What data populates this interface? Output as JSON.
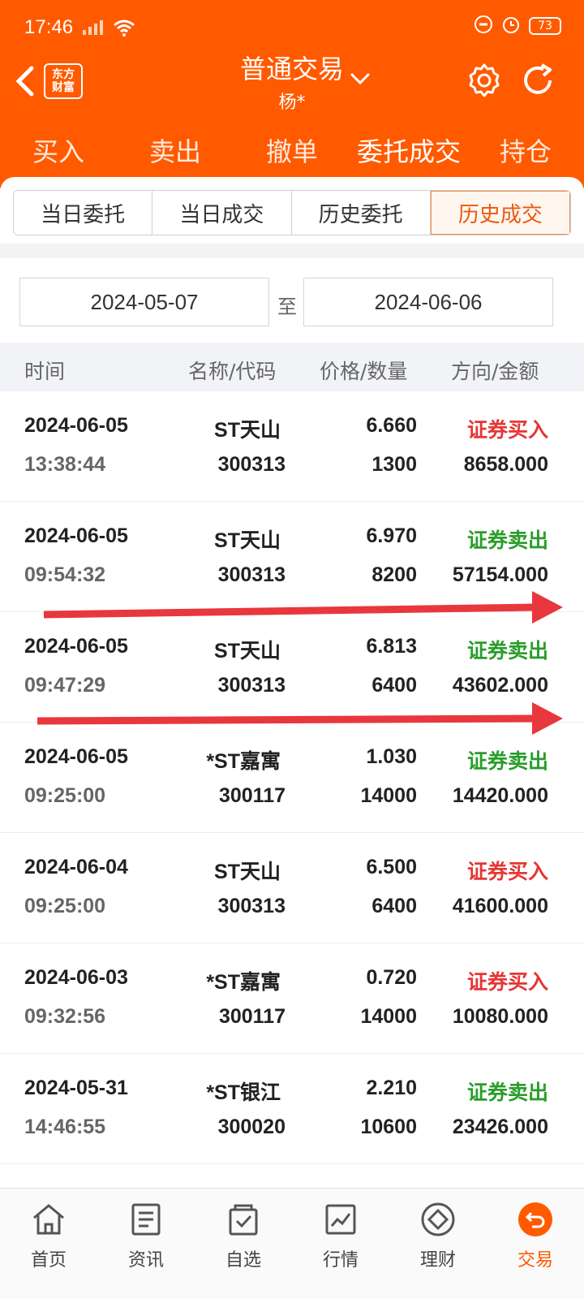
{
  "status_bar": {
    "time": "17:46",
    "battery": "73"
  },
  "header": {
    "logo_line1": "东方",
    "logo_line2": "财富",
    "title": "普通交易",
    "subtitle": "杨*"
  },
  "main_tabs": [
    {
      "label": "买入"
    },
    {
      "label": "卖出"
    },
    {
      "label": "撤单"
    },
    {
      "label": "委托成交",
      "active": true
    },
    {
      "label": "持仓"
    }
  ],
  "sub_tabs": [
    {
      "label": "当日委托"
    },
    {
      "label": "当日成交"
    },
    {
      "label": "历史委托"
    },
    {
      "label": "历史成交",
      "active": true
    }
  ],
  "date_range": {
    "start": "2024-05-07",
    "separator": "至",
    "end": "2024-06-06"
  },
  "table": {
    "headers": [
      "时间",
      "名称/代码",
      "价格/数量",
      "方向/金额"
    ],
    "rows": [
      {
        "date": "2024-06-05",
        "time": "13:38:44",
        "name": "ST天山",
        "code": "300313",
        "price": "6.660",
        "qty": "1300",
        "direction": "证券买入",
        "amount": "8658.000",
        "side": "buy"
      },
      {
        "date": "2024-06-05",
        "time": "09:54:32",
        "name": "ST天山",
        "code": "300313",
        "price": "6.970",
        "qty": "8200",
        "direction": "证券卖出",
        "amount": "57154.000",
        "side": "sell"
      },
      {
        "date": "2024-06-05",
        "time": "09:47:29",
        "name": "ST天山",
        "code": "300313",
        "price": "6.813",
        "qty": "6400",
        "direction": "证券卖出",
        "amount": "43602.000",
        "side": "sell"
      },
      {
        "date": "2024-06-05",
        "time": "09:25:00",
        "name": "*ST嘉寓",
        "code": "300117",
        "price": "1.030",
        "qty": "14000",
        "direction": "证券卖出",
        "amount": "14420.000",
        "side": "sell"
      },
      {
        "date": "2024-06-04",
        "time": "09:25:00",
        "name": "ST天山",
        "code": "300313",
        "price": "6.500",
        "qty": "6400",
        "direction": "证券买入",
        "amount": "41600.000",
        "side": "buy"
      },
      {
        "date": "2024-06-03",
        "time": "09:32:56",
        "name": "*ST嘉寓",
        "code": "300117",
        "price": "0.720",
        "qty": "14000",
        "direction": "证券买入",
        "amount": "10080.000",
        "side": "buy"
      },
      {
        "date": "2024-05-31",
        "time": "14:46:55",
        "name": "*ST银江",
        "code": "300020",
        "price": "2.210",
        "qty": "10600",
        "direction": "证券卖出",
        "amount": "23426.000",
        "side": "sell"
      }
    ]
  },
  "bottom_nav": [
    {
      "label": "首页",
      "icon": "home-icon"
    },
    {
      "label": "资讯",
      "icon": "news-icon"
    },
    {
      "label": "自选",
      "icon": "watchlist-icon"
    },
    {
      "label": "行情",
      "icon": "chart-icon"
    },
    {
      "label": "理财",
      "icon": "wealth-icon"
    },
    {
      "label": "交易",
      "icon": "trade-icon",
      "active": true
    }
  ],
  "colors": {
    "brand": "#ff5a00",
    "buy": "#e63535",
    "sell": "#2a9d2a",
    "annotation_arrow": "#e8373d"
  }
}
